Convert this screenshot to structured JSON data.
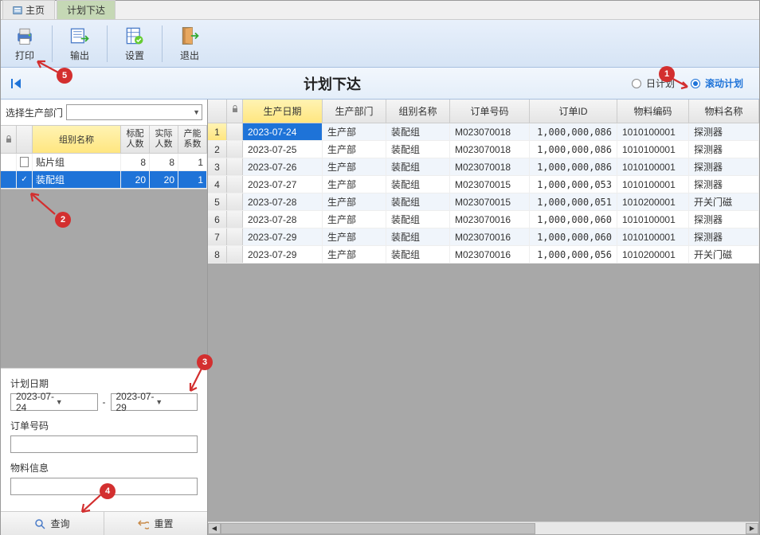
{
  "tabs": {
    "home": "主页",
    "plan": "计划下达"
  },
  "toolbar": {
    "print": "打印",
    "export": "输出",
    "settings": "设置",
    "exit": "退出"
  },
  "title": "计划下达",
  "plan_type": {
    "daily": "日计划",
    "rolling": "滚动计划"
  },
  "left": {
    "dept_label": "选择生产部门",
    "header": {
      "name": "组别名称",
      "std": "标配人数",
      "act": "实际人数",
      "cap": "产能系数"
    },
    "rows": [
      {
        "name": "贴片组",
        "std": "8",
        "act": "8",
        "cap": "1",
        "checked": false
      },
      {
        "name": "装配组",
        "std": "20",
        "act": "20",
        "cap": "1",
        "checked": true
      }
    ],
    "filter": {
      "date_label": "计划日期",
      "date_from": "2023-07-24",
      "date_to": "2023-07-29",
      "order_label": "订单号码",
      "material_label": "物料信息"
    },
    "actions": {
      "query": "查询",
      "reset": "重置"
    }
  },
  "main": {
    "header": {
      "date": "生产日期",
      "dept": "生产部门",
      "group": "组别名称",
      "order": "订单号码",
      "orderid": "订单ID",
      "matcode": "物料编码",
      "matname": "物料名称"
    },
    "rows": [
      {
        "n": "1",
        "date": "2023-07-24",
        "dept": "生产部",
        "group": "装配组",
        "order": "M023070018",
        "orderid": "1,000,000,086",
        "matcode": "1010100001",
        "matname": "探测器"
      },
      {
        "n": "2",
        "date": "2023-07-25",
        "dept": "生产部",
        "group": "装配组",
        "order": "M023070018",
        "orderid": "1,000,000,086",
        "matcode": "1010100001",
        "matname": "探测器"
      },
      {
        "n": "3",
        "date": "2023-07-26",
        "dept": "生产部",
        "group": "装配组",
        "order": "M023070018",
        "orderid": "1,000,000,086",
        "matcode": "1010100001",
        "matname": "探测器"
      },
      {
        "n": "4",
        "date": "2023-07-27",
        "dept": "生产部",
        "group": "装配组",
        "order": "M023070015",
        "orderid": "1,000,000,053",
        "matcode": "1010100001",
        "matname": "探测器"
      },
      {
        "n": "5",
        "date": "2023-07-28",
        "dept": "生产部",
        "group": "装配组",
        "order": "M023070015",
        "orderid": "1,000,000,051",
        "matcode": "1010200001",
        "matname": "开关门磁"
      },
      {
        "n": "6",
        "date": "2023-07-28",
        "dept": "生产部",
        "group": "装配组",
        "order": "M023070016",
        "orderid": "1,000,000,060",
        "matcode": "1010100001",
        "matname": "探测器"
      },
      {
        "n": "7",
        "date": "2023-07-29",
        "dept": "生产部",
        "group": "装配组",
        "order": "M023070016",
        "orderid": "1,000,000,060",
        "matcode": "1010100001",
        "matname": "探测器"
      },
      {
        "n": "8",
        "date": "2023-07-29",
        "dept": "生产部",
        "group": "装配组",
        "order": "M023070016",
        "orderid": "1,000,000,056",
        "matcode": "1010200001",
        "matname": "开关门磁"
      }
    ]
  },
  "annotations": [
    "1",
    "2",
    "3",
    "4",
    "5"
  ]
}
